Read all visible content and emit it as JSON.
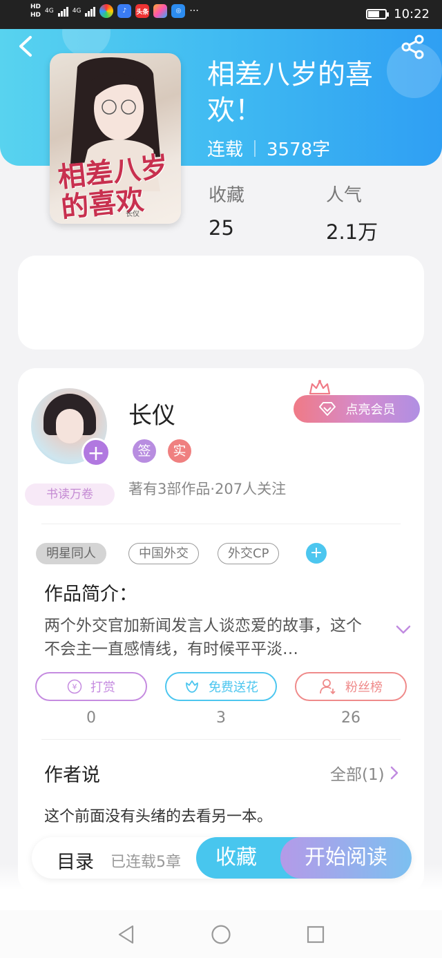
{
  "status_bar": {
    "hd_top": "HD",
    "hd_bottom": "HD",
    "net1": "4G",
    "net2": "4G",
    "app_news": "头条",
    "more": "···",
    "time": "10:22",
    "battery_level": 0.65
  },
  "book": {
    "title": "相差八岁的喜欢！",
    "cover_title": "相差八岁的喜欢",
    "cover_author": "长仪",
    "status": "连载",
    "word_count": "3578字",
    "stats": [
      {
        "label": "收藏",
        "value": "25"
      },
      {
        "label": "人气",
        "value": "2.1万"
      }
    ]
  },
  "author": {
    "name": "长仪",
    "badges": [
      "签",
      "实"
    ],
    "summary": "著有3部作品·207人关注",
    "reader_badge": "书读万卷",
    "member_button": "点亮会员"
  },
  "tags": [
    "明星同人",
    "中国外交",
    "外交CP"
  ],
  "intro": {
    "title": "作品简介：",
    "text": "两个外交官加新闻发言人谈恋爱的故事，这个不会主一直感情线，有时候平平淡…"
  },
  "actions": [
    {
      "label": "打赏",
      "count": "0",
      "color": "#c58be0"
    },
    {
      "label": "免费送花",
      "count": "3",
      "color": "#4cc6ef"
    },
    {
      "label": "粉丝榜",
      "count": "26",
      "color": "#ef8a8a"
    }
  ],
  "author_says": {
    "title": "作者说",
    "all_label": "全部(1)",
    "text": "这个前面没有头绪的去看另一本。"
  },
  "bottom_bar": {
    "toc": "目录",
    "chapters": "已连载5章",
    "collect": "收藏",
    "read": "开始阅读"
  },
  "colors": {
    "header_start": "#58d3ef",
    "header_end": "#2f9ff3",
    "accent_blue": "#48c6ee",
    "accent_purple": "#b178e0"
  },
  "icons": [
    "back-icon",
    "share-icon",
    "crown-icon",
    "diamond-icon",
    "yen-icon",
    "flower-icon",
    "fan-icon",
    "chevron-right-icon",
    "chevron-down-icon",
    "nav-back-icon",
    "nav-home-icon",
    "nav-recent-icon"
  ]
}
